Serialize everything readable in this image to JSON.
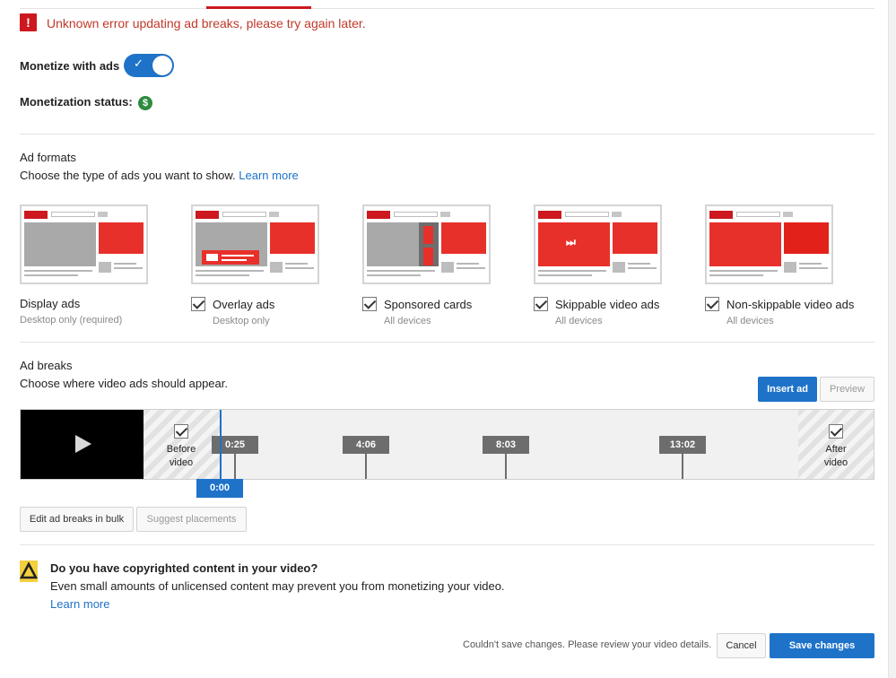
{
  "error": {
    "icon": "exclamation-icon",
    "message": "Unknown error updating ad breaks, please try again later."
  },
  "monetize": {
    "label": "Monetize with ads",
    "enabled": true
  },
  "monetization_status": {
    "label": "Monetization status:",
    "icon": "dollar-icon"
  },
  "ad_formats": {
    "title": "Ad formats",
    "description": "Choose the type of ads you want to show.",
    "learn_more": "Learn more",
    "items": [
      {
        "name": "Display ads",
        "note": "Desktop only (required)",
        "checkbox": false
      },
      {
        "name": "Overlay ads",
        "note": "Desktop only",
        "checkbox": true,
        "checked": true
      },
      {
        "name": "Sponsored cards",
        "note": "All devices",
        "checkbox": true,
        "checked": true
      },
      {
        "name": "Skippable video ads",
        "note": "All devices",
        "checkbox": true,
        "checked": true
      },
      {
        "name": "Non-skippable video ads",
        "note": "All devices",
        "checkbox": true,
        "checked": true
      }
    ]
  },
  "ad_breaks": {
    "title": "Ad breaks",
    "description": "Choose where video ads should appear.",
    "insert_ad": "Insert ad",
    "preview": "Preview",
    "before_video": "Before video",
    "after_video": "After video",
    "playhead": "0:00",
    "markers": [
      "0:25",
      "4:06",
      "8:03",
      "13:02"
    ],
    "edit_bulk": "Edit ad breaks in bulk",
    "suggest": "Suggest placements"
  },
  "copyright": {
    "title": "Do you have copyrighted content in your video?",
    "body": "Even small amounts of unlicensed content may prevent you from monetizing your video.",
    "learn_more": "Learn more"
  },
  "footer": {
    "status": "Couldn't save changes. Please review your video details.",
    "cancel": "Cancel",
    "save": "Save changes"
  },
  "colors": {
    "accent": "#1e73c9",
    "error": "#cc181e",
    "ad_red": "#e8302a"
  }
}
